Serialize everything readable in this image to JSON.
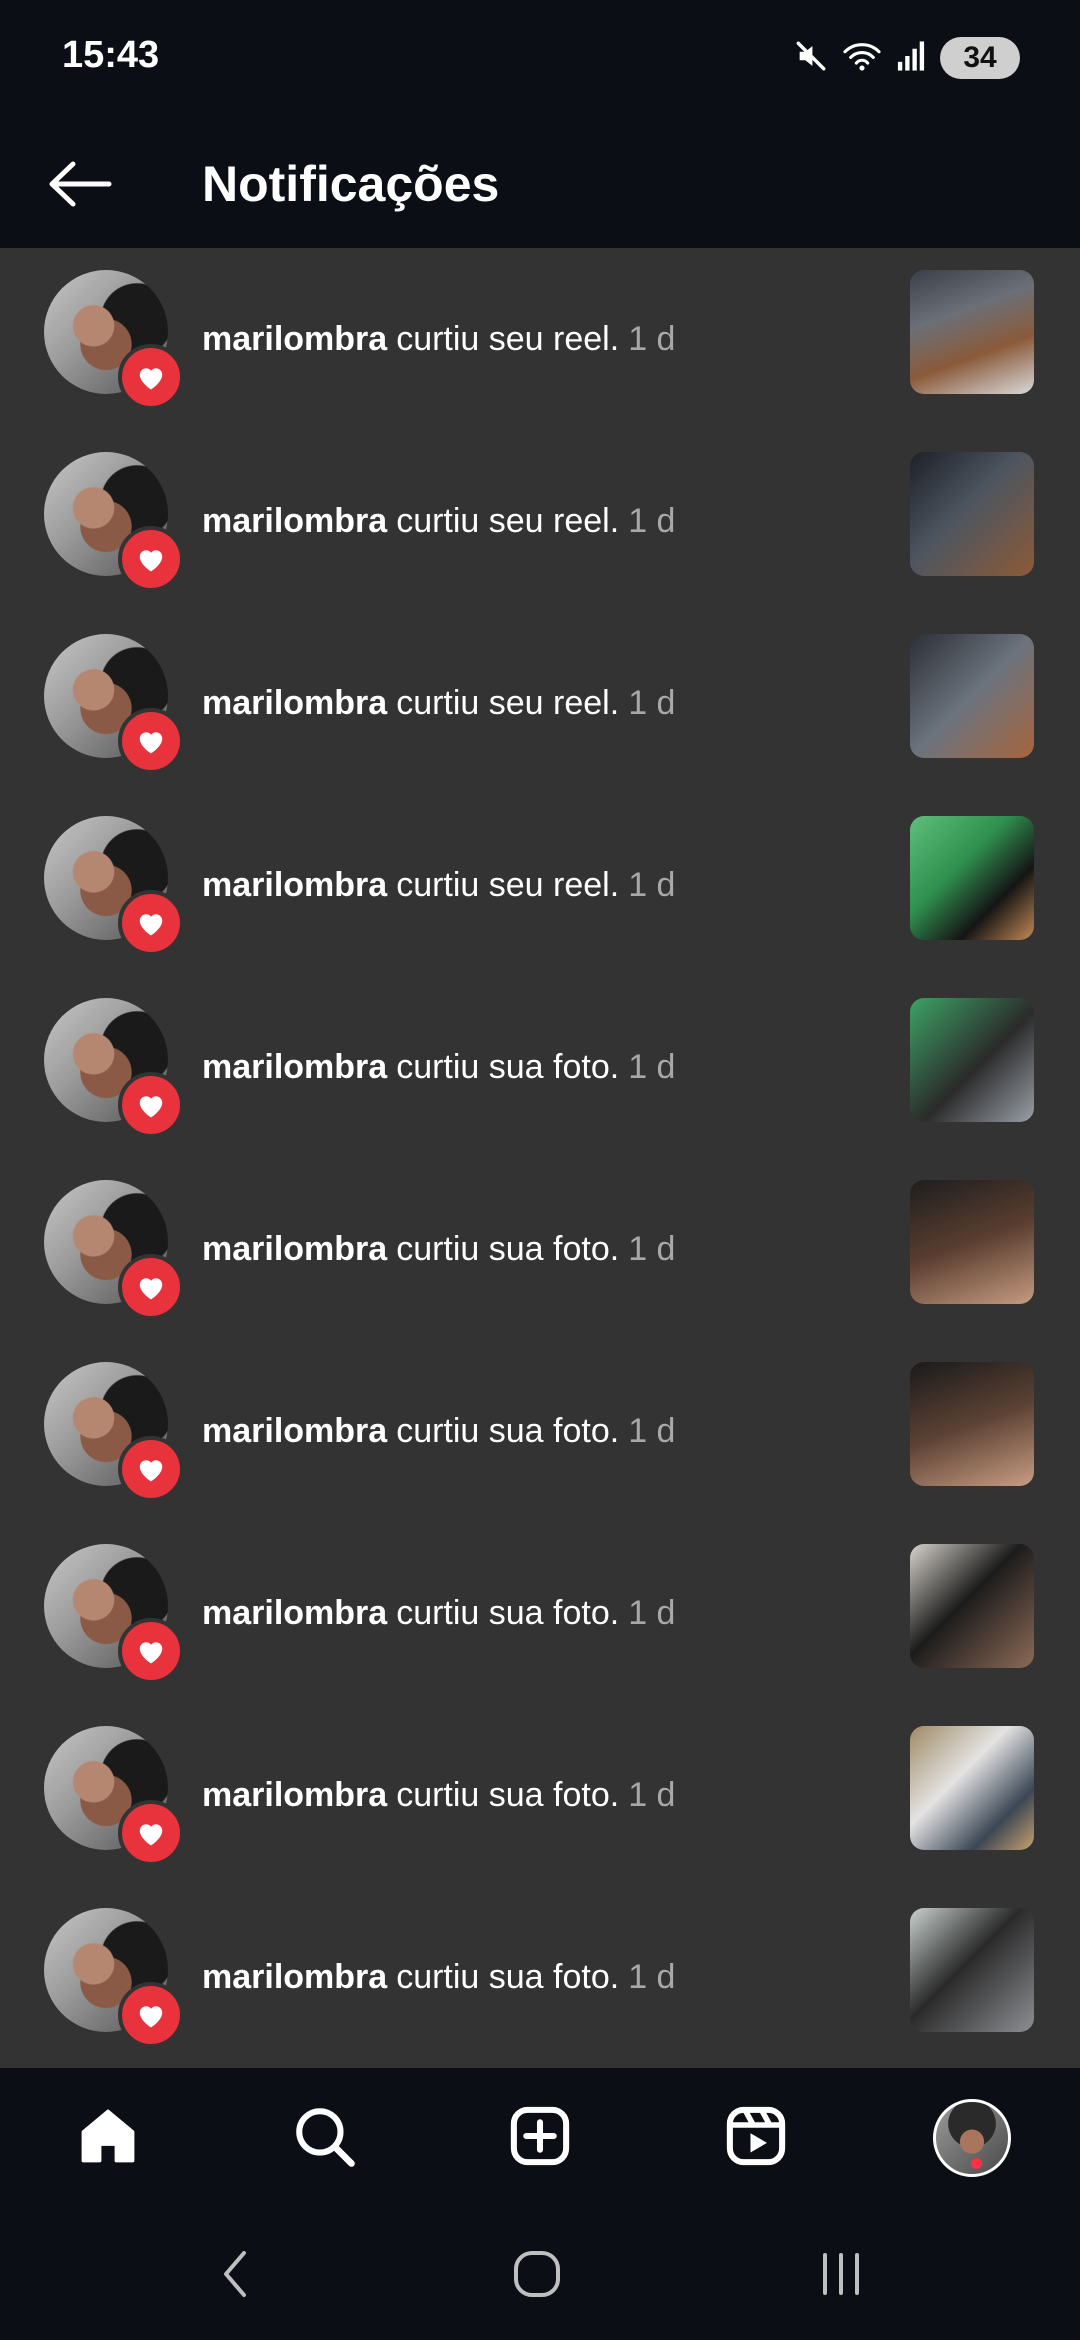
{
  "status_bar": {
    "time": "15:43",
    "battery": "34",
    "icons": [
      "mute-icon",
      "wifi-icon",
      "signal-icon"
    ]
  },
  "header": {
    "title": "Notificações",
    "back_icon": "arrow-left-icon"
  },
  "colors": {
    "background": "#333333",
    "bar_background": "#0b0e14",
    "heart_badge": "#e8323c",
    "time_text": "#a8a8a8",
    "notification_dot": "#ff3040"
  },
  "notifications": [
    {
      "username": "marilombra",
      "action": "curtiu seu reel.",
      "time": "1 d"
    },
    {
      "username": "marilombra",
      "action": "curtiu seu reel.",
      "time": "1 d"
    },
    {
      "username": "marilombra",
      "action": "curtiu seu reel.",
      "time": "1 d"
    },
    {
      "username": "marilombra",
      "action": "curtiu seu reel.",
      "time": "1 d"
    },
    {
      "username": "marilombra",
      "action": "curtiu sua foto.",
      "time": "1 d"
    },
    {
      "username": "marilombra",
      "action": "curtiu sua foto.",
      "time": "1 d"
    },
    {
      "username": "marilombra",
      "action": "curtiu sua foto.",
      "time": "1 d"
    },
    {
      "username": "marilombra",
      "action": "curtiu sua foto.",
      "time": "1 d"
    },
    {
      "username": "marilombra",
      "action": "curtiu sua foto.",
      "time": "1 d"
    },
    {
      "username": "marilombra",
      "action": "curtiu sua foto.",
      "time": "1 d"
    }
  ],
  "bottom_nav": {
    "items": [
      "home-icon",
      "search-icon",
      "create-icon",
      "reels-icon",
      "profile-avatar"
    ]
  },
  "system_nav": {
    "items": [
      "back-icon",
      "home-circle-icon",
      "recents-icon"
    ]
  }
}
